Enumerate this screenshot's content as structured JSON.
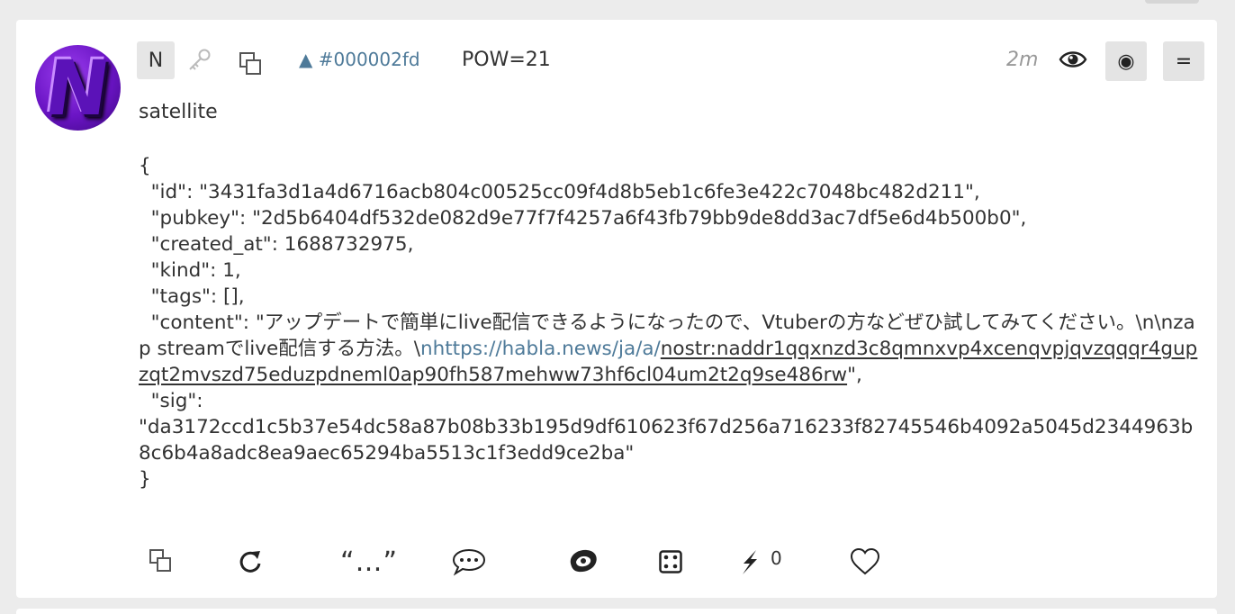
{
  "post": {
    "badge_letter": "N",
    "id_label": "▲ #000002fd",
    "pow_label": "POW=21",
    "time_ago": "2m",
    "author_name": "satellite",
    "circle_button_label": "◉",
    "menu_button_label": "=",
    "avatar_letter": "N"
  },
  "content": {
    "open_brace": "{",
    "line_id": "  \"id\": \"3431fa3d1a4d6716acb804c00525cc09f4d8b5eb1c6fe3e422c7048bc482d211\",",
    "line_pubkey": "  \"pubkey\": \"2d5b6404df532de082d9e77f7f4257a6f43fb79bb9de8dd3ac7df5e6d4b500b0\",",
    "line_created": "  \"created_at\": 1688732975,",
    "line_kind": "  \"kind\": 1,",
    "line_tags": "  \"tags\": [],",
    "content_prefix": "  \"content\": \"アップデートで簡単にlive配信できるようになったので、Vtuberの方などぜひ試してみてください。\\n\\nzap streamでlive配信する方法。\\",
    "content_link": "nhttps://habla.news/ja/a/",
    "content_nostr": "nostr:naddr1qqxnzd3c8qmnxvp4xcenqvpjqvzqqqr4gupzqt2mvszd75eduzpdneml0ap90fh587mehww73hf6cl04um2t2q9se486rw",
    "content_suffix": "\",",
    "line_sig_key": "  \"sig\":",
    "line_sig_value": "\"da3172ccd1c5b37e54dc58a87b08b33b195d9df610623f67d256a716233f82745546b4092a5045d2344963b8c6b4a8adc8ea9aec65294ba5513c1f3edd9ce2ba\"",
    "close_brace": "}"
  },
  "actions": {
    "quote_label": "“…”",
    "zap_count": "0"
  },
  "colors": {
    "link": "#4e7a99",
    "avatar": "#6a14c4",
    "button_bg": "#e4e4e4"
  },
  "icons": [
    "key-icon",
    "copy-icon",
    "eye-icon",
    "repost-icon",
    "reply-icon",
    "reaction-icon",
    "dice-icon",
    "zap-icon",
    "heart-icon"
  ]
}
